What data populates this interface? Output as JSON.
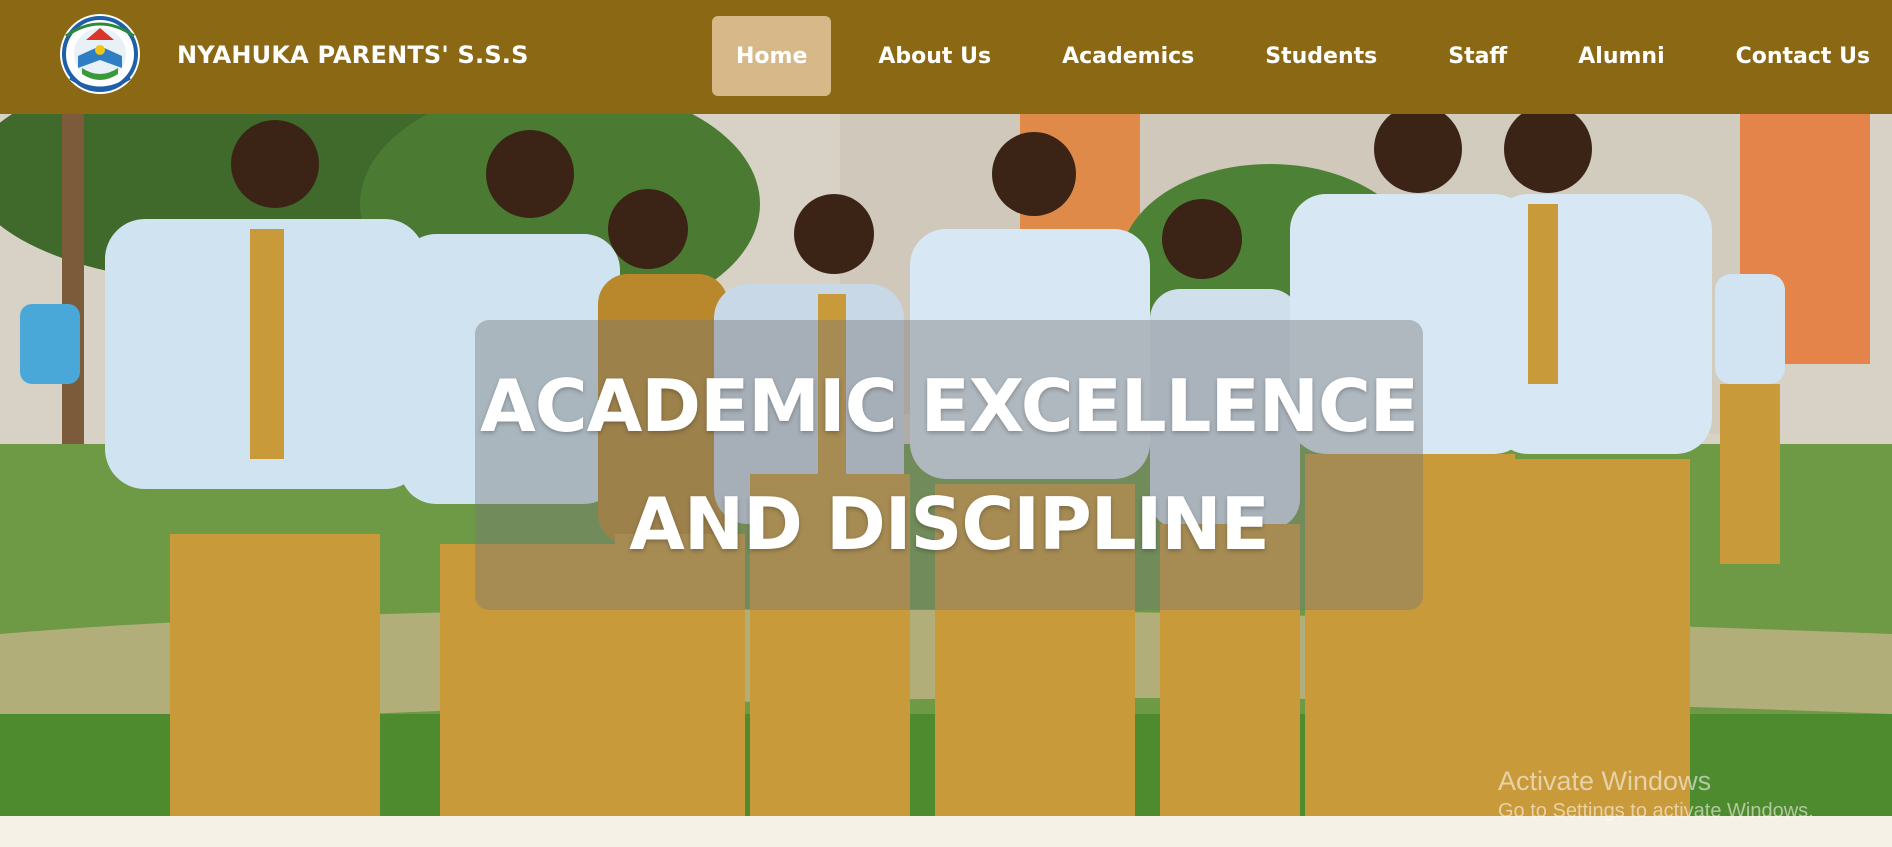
{
  "header": {
    "school_name": "NYAHUKA PARENTS' S.S.S",
    "logo_icon": "school-crest-icon"
  },
  "nav": {
    "items": [
      {
        "label": "Home",
        "active": true
      },
      {
        "label": "About Us",
        "active": false
      },
      {
        "label": "Academics",
        "active": false
      },
      {
        "label": "Students",
        "active": false
      },
      {
        "label": "Staff",
        "active": false
      },
      {
        "label": "Alumni",
        "active": false
      },
      {
        "label": "Contact Us",
        "active": false
      }
    ]
  },
  "hero": {
    "line1": "ACADEMIC EXCELLENCE",
    "line2": "AND DISCIPLINE"
  },
  "watermark": {
    "title": "Activate Windows",
    "subtitle": "Go to Settings to activate Windows."
  },
  "colors": {
    "navbar": "#8b6914",
    "active_tab": "#d6b889",
    "uniform_shirt": "#cfe3f1",
    "uniform_trousers": "#c99a3a"
  }
}
